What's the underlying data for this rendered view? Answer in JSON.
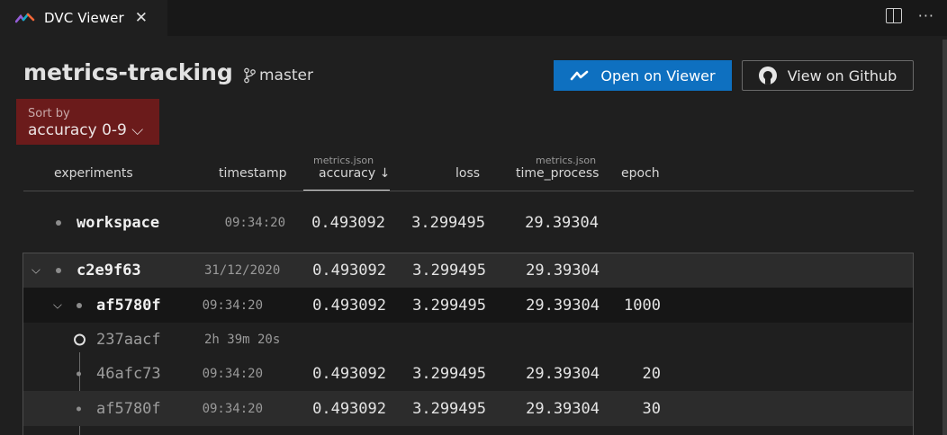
{
  "tab": {
    "title": "DVC Viewer",
    "close_glyph": "✕",
    "more_glyph": "···"
  },
  "header": {
    "project": "metrics-tracking",
    "branch": "master",
    "open_viewer_label": "Open on Viewer",
    "github_label": "View on Github"
  },
  "sort": {
    "label": "Sort by",
    "value": "accuracy 0-9 ⌵"
  },
  "columns": {
    "experiments": "experiments",
    "timestamp": "timestamp",
    "accuracy_source": "metrics.json",
    "accuracy": "accuracy ↓",
    "loss": "loss",
    "time_process_source": "metrics.json",
    "time_process": "time_process",
    "epoch": "epoch"
  },
  "rows": [
    {
      "name": "workspace",
      "timestamp": "09:34:20",
      "accuracy": "0.493092",
      "loss": "3.299495",
      "time_process": "29.39304",
      "epoch": ""
    },
    {
      "name": "c2e9f63",
      "timestamp": "31/12/2020",
      "accuracy": "0.493092",
      "loss": "3.299495",
      "time_process": "29.39304",
      "epoch": ""
    },
    {
      "name": "af5780f",
      "timestamp": "09:34:20",
      "accuracy": "0.493092",
      "loss": "3.299495",
      "time_process": "29.39304",
      "epoch": "1000"
    },
    {
      "name": "237aacf",
      "timestamp": "2h 39m 20s",
      "accuracy": "",
      "loss": "",
      "time_process": "",
      "epoch": ""
    },
    {
      "name": "46afc73",
      "timestamp": "09:34:20",
      "accuracy": "0.493092",
      "loss": "3.299495",
      "time_process": "29.39304",
      "epoch": "20"
    },
    {
      "name": "af5780f",
      "timestamp": "09:34:20",
      "accuracy": "0.493092",
      "loss": "3.299495",
      "time_process": "29.39304",
      "epoch": "30"
    }
  ],
  "colors": {
    "accent": "#0e70c0",
    "sort_bg": "#6b1b1b",
    "background": "#1f1f1f"
  }
}
